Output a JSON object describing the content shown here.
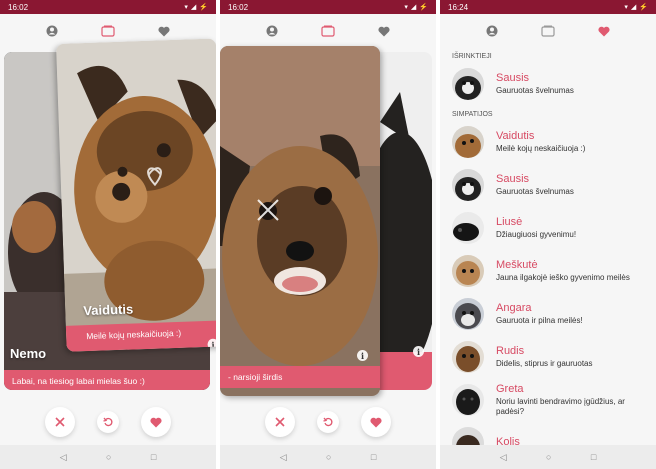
{
  "colors": {
    "status_bar": "#8a1732",
    "accent": "#e05a70",
    "name_text": "#d74a63"
  },
  "screens": [
    {
      "time": "16:02",
      "tabs": [
        {
          "icon": "profile-icon",
          "active": false
        },
        {
          "icon": "cards-icon",
          "active": true
        },
        {
          "icon": "heart-icon",
          "active": false
        }
      ],
      "back_card": {
        "name": "Nemo",
        "text": "Labai, na tiesiog labai mielas šuo :)"
      },
      "front_card": {
        "name": "Vaidutis",
        "text": "Meilė kojų neskaičiuoja :)"
      },
      "actions": [
        "close-icon",
        "undo-icon",
        "heart-icon"
      ]
    },
    {
      "time": "16:02",
      "tabs": [
        {
          "icon": "profile-icon",
          "active": false
        },
        {
          "icon": "cards-icon",
          "active": true
        },
        {
          "icon": "heart-icon",
          "active": false
        }
      ],
      "front_card": {
        "text": "- narsioji širdis"
      },
      "actions": [
        "close-icon",
        "undo-icon",
        "heart-icon"
      ]
    },
    {
      "time": "16:24",
      "tabs": [
        {
          "icon": "profile-icon",
          "active": false
        },
        {
          "icon": "cards-icon",
          "active": false
        },
        {
          "icon": "heart-icon",
          "active": true
        }
      ],
      "favorites_label": "IŠRINKTIEJI",
      "favorites": [
        {
          "name": "Sausis",
          "desc": "Gauruotas švelnumas"
        }
      ],
      "likes_label": "SIMPATIJOS",
      "likes": [
        {
          "name": "Vaidutis",
          "desc": "Meilė kojų neskaičiuoja :)"
        },
        {
          "name": "Sausis",
          "desc": "Gauruotas švelnumas"
        },
        {
          "name": "Liusė",
          "desc": "Džiaugiuosi gyvenimu!"
        },
        {
          "name": "Meškutė",
          "desc": "Jauna ilgakojė ieško gyvenimo meilės"
        },
        {
          "name": "Angara",
          "desc": "Gauruota ir pilna meilės!"
        },
        {
          "name": "Rudis",
          "desc": "Didelis, stiprus ir gauruotas"
        },
        {
          "name": "Greta",
          "desc": "Noriu lavinti bendravimo įgūdžius, ar padėsi?"
        },
        {
          "name": "Kolis",
          "desc": ""
        }
      ]
    }
  ]
}
